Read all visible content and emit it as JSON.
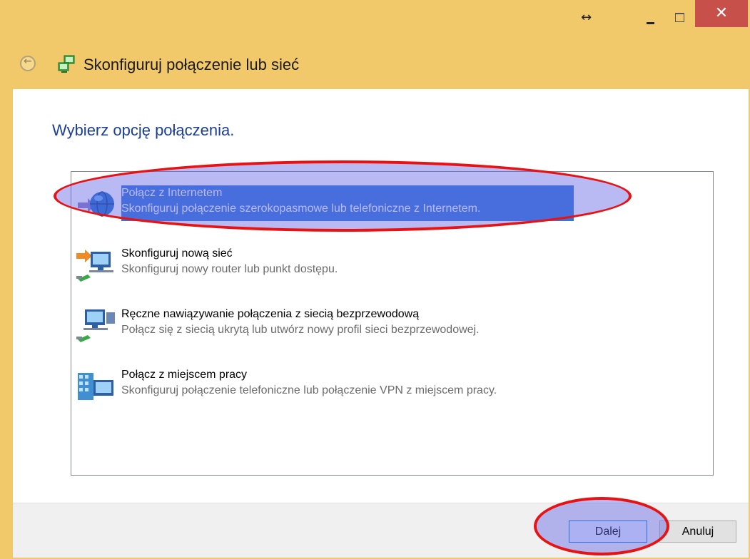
{
  "titlebar": {
    "resize_glyph": "↔",
    "close_glyph": "✕"
  },
  "header": {
    "title": "Skonfiguruj połączenie lub sieć"
  },
  "main": {
    "instruction": "Wybierz opcję połączenia.",
    "options": [
      {
        "title": "Połącz z Internetem",
        "description": "Skonfiguruj połączenie szerokopasmowe lub telefoniczne z Internetem.",
        "icon": "globe-network-icon",
        "selected": true
      },
      {
        "title": "Skonfiguruj nową sieć",
        "description": "Skonfiguruj nowy router lub punkt dostępu.",
        "icon": "new-network-icon",
        "selected": false
      },
      {
        "title": "Ręczne nawiązywanie połączenia z siecią bezprzewodową",
        "description": "Połącz się z siecią ukrytą lub utwórz nowy profil sieci bezprzewodowej.",
        "icon": "wireless-network-icon",
        "selected": false
      },
      {
        "title": "Połącz z miejscem pracy",
        "description": "Skonfiguruj połączenie telefoniczne lub połączenie VPN z miejscem pracy.",
        "icon": "workplace-building-icon",
        "selected": false
      }
    ]
  },
  "footer": {
    "next_label": "Dalej",
    "cancel_label": "Anuluj"
  },
  "colors": {
    "frame": "#f2c96a",
    "selection": "#3277d6",
    "instruction_text": "#1c3f94",
    "close_button": "#c7504b",
    "annotation_outline": "#e81212"
  }
}
